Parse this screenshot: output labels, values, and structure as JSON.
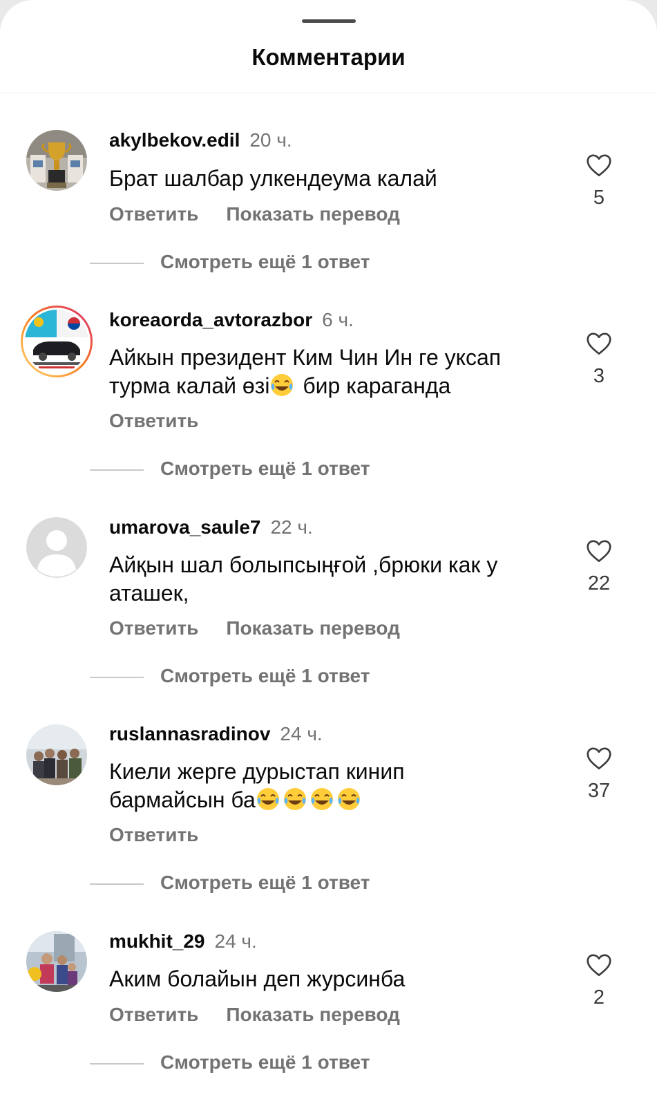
{
  "sheet": {
    "title": "Комментарии"
  },
  "labels": {
    "reply": "Ответить",
    "translate": "Показать перевод"
  },
  "comments": [
    {
      "username": "akylbekov.edil",
      "time": "20 ч.",
      "text": "Брат шалбар улкендеума калай",
      "likes": "5",
      "replies": "Смотреть ещё 1 ответ",
      "avatar": "trophy-photo-avatar"
    },
    {
      "username": "koreaorda_avtorazbor",
      "time": "6 ч.",
      "text_line1": "Айкын президент Ким Чин Ин ге уксап",
      "text_line2a": "турма калай өзі",
      "text_line2b": " бир караганда",
      "likes": "3",
      "replies": "Смотреть ещё 1 ответ",
      "avatar": "car-flags-avatar"
    },
    {
      "username": "umarova_saule7",
      "time": "22 ч.",
      "text_line1": "Айқын шал болыпсыңғой ,брюки как у",
      "text_line2": "аташек,",
      "likes": "22",
      "replies": "Смотреть ещё 1 ответ",
      "avatar": "default-person-avatar"
    },
    {
      "username": "ruslannasradinov",
      "time": "24 ч.",
      "text_line1": "Киели жерге дурыстап кинип",
      "text_line2": "бармайсын ба",
      "likes": "37",
      "replies": "Смотреть ещё 1 ответ",
      "avatar": "group-photo-avatar"
    },
    {
      "username": "mukhit_29",
      "time": "24 ч.",
      "text": "Аким болайын деп журсинба",
      "likes": "2",
      "replies": "Смотреть ещё 1 ответ",
      "avatar": "family-photo-avatar"
    }
  ],
  "icons": {
    "like": "heart-outline-icon",
    "emoji": "tears-of-joy-emoji"
  },
  "colors": {
    "primary_text": "#0a0a0a",
    "secondary_text": "#737373",
    "background": "#ffffff",
    "story_ring_start": "#feda75",
    "story_ring_end": "#d62976"
  }
}
